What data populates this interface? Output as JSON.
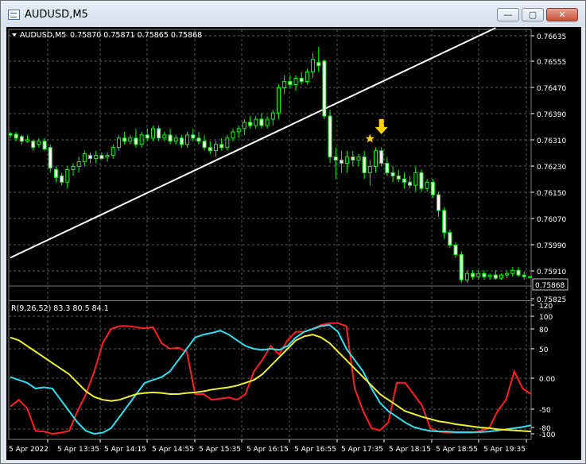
{
  "window": {
    "title": "AUDUSD,M5",
    "buttons": {
      "minimize": "—",
      "maximize": "▢",
      "close": "✕"
    }
  },
  "chart_data": {
    "symbol_label": "AUDUSD,M5",
    "ohlc_label": "0.75870 0.75871 0.75865 0.75868",
    "price_axis": [
      "0.76635",
      "0.76555",
      "0.76470",
      "0.76390",
      "0.76310",
      "0.76230",
      "0.76150",
      "0.76070",
      "0.75990",
      "0.75910",
      "0.75825"
    ],
    "current_price": "0.75868",
    "indicator_label": "R(9,26,52) 83.3 80.5 84.1",
    "indicator_axis": [
      "120",
      "100",
      "80",
      "50",
      "0.00",
      "-50",
      "-80",
      "-100"
    ],
    "time_axis": [
      "5 Apr 2022",
      "5 Apr 13:35",
      "5 Apr 14:15",
      "5 Apr 14:55",
      "5 Apr 15:35",
      "5 Apr 16:15",
      "5 Apr 16:55",
      "5 Apr 17:35",
      "5 Apr 18:15",
      "5 Apr 18:55",
      "5 Apr 19:35"
    ],
    "candles": [
      [
        0.76324,
        0.7633,
        0.7631,
        0.7632
      ],
      [
        0.76322,
        0.7633,
        0.763,
        0.7631
      ],
      [
        0.76315,
        0.7632,
        0.7629,
        0.763
      ],
      [
        0.763,
        0.7632,
        0.76295,
        0.76305
      ],
      [
        0.763,
        0.76305,
        0.7627,
        0.7628
      ],
      [
        0.7629,
        0.7631,
        0.7628,
        0.763
      ],
      [
        0.763,
        0.7631,
        0.7627,
        0.76275
      ],
      [
        0.7628,
        0.7629,
        0.762,
        0.76215
      ],
      [
        0.7621,
        0.7622,
        0.7617,
        0.76185
      ],
      [
        0.7619,
        0.762,
        0.7616,
        0.7617
      ],
      [
        0.7617,
        0.7622,
        0.7615,
        0.7621
      ],
      [
        0.7621,
        0.7623,
        0.7619,
        0.7622
      ],
      [
        0.7622,
        0.7625,
        0.762,
        0.76235
      ],
      [
        0.76235,
        0.7627,
        0.7622,
        0.7626
      ],
      [
        0.76255,
        0.76265,
        0.7623,
        0.76245
      ],
      [
        0.76245,
        0.7627,
        0.7623,
        0.76255
      ],
      [
        0.76255,
        0.76265,
        0.7624,
        0.76245
      ],
      [
        0.7625,
        0.76265,
        0.76235,
        0.76255
      ],
      [
        0.76255,
        0.7629,
        0.76245,
        0.7628
      ],
      [
        0.7628,
        0.7632,
        0.7627,
        0.7631
      ],
      [
        0.7631,
        0.7633,
        0.7629,
        0.763
      ],
      [
        0.763,
        0.7632,
        0.7629,
        0.7631
      ],
      [
        0.7631,
        0.7634,
        0.7628,
        0.7629
      ],
      [
        0.7629,
        0.7633,
        0.7628,
        0.7632
      ],
      [
        0.7632,
        0.7634,
        0.763,
        0.7631
      ],
      [
        0.7631,
        0.7635,
        0.763,
        0.7634
      ],
      [
        0.7634,
        0.7635,
        0.763,
        0.7631
      ],
      [
        0.7631,
        0.7633,
        0.763,
        0.7632
      ],
      [
        0.7632,
        0.7634,
        0.7629,
        0.763
      ],
      [
        0.763,
        0.7632,
        0.7629,
        0.7631
      ],
      [
        0.7631,
        0.7632,
        0.7628,
        0.7629
      ],
      [
        0.7629,
        0.7633,
        0.7628,
        0.7632
      ],
      [
        0.7632,
        0.7634,
        0.763,
        0.7631
      ],
      [
        0.7631,
        0.7633,
        0.7629,
        0.763
      ],
      [
        0.763,
        0.7632,
        0.7627,
        0.7628
      ],
      [
        0.7628,
        0.763,
        0.7626,
        0.7627
      ],
      [
        0.7627,
        0.763,
        0.7625,
        0.7629
      ],
      [
        0.7629,
        0.7631,
        0.7627,
        0.7628
      ],
      [
        0.7628,
        0.7632,
        0.7627,
        0.7631
      ],
      [
        0.7631,
        0.7634,
        0.763,
        0.7633
      ],
      [
        0.7633,
        0.7635,
        0.7631,
        0.7634
      ],
      [
        0.7634,
        0.7637,
        0.7632,
        0.7636
      ],
      [
        0.7636,
        0.7638,
        0.7634,
        0.7635
      ],
      [
        0.7635,
        0.7638,
        0.7634,
        0.7637
      ],
      [
        0.7637,
        0.7639,
        0.7634,
        0.7635
      ],
      [
        0.7635,
        0.7638,
        0.7634,
        0.7637
      ],
      [
        0.7637,
        0.764,
        0.7635,
        0.7639
      ],
      [
        0.7639,
        0.7648,
        0.7637,
        0.7647
      ],
      [
        0.7647,
        0.7651,
        0.7645,
        0.7649
      ],
      [
        0.7649,
        0.7651,
        0.7647,
        0.7648
      ],
      [
        0.7648,
        0.7651,
        0.7646,
        0.765
      ],
      [
        0.765,
        0.7652,
        0.7648,
        0.7649
      ],
      [
        0.7649,
        0.7653,
        0.7648,
        0.7652
      ],
      [
        0.7652,
        0.7658,
        0.765,
        0.7656
      ],
      [
        0.7655,
        0.766,
        0.7652,
        0.7654
      ],
      [
        0.76555,
        0.7656,
        0.7637,
        0.7638
      ],
      [
        0.7638,
        0.764,
        0.7623,
        0.7625
      ],
      [
        0.7625,
        0.7628,
        0.7618,
        0.7624
      ],
      [
        0.7624,
        0.7627,
        0.762,
        0.7623
      ],
      [
        0.7623,
        0.7627,
        0.762,
        0.7625
      ],
      [
        0.7625,
        0.7627,
        0.7622,
        0.7624
      ],
      [
        0.7624,
        0.7626,
        0.7622,
        0.7625
      ],
      [
        0.7625,
        0.7627,
        0.7618,
        0.762
      ],
      [
        0.762,
        0.7624,
        0.7616,
        0.7622
      ],
      [
        0.7622,
        0.7628,
        0.762,
        0.7627
      ],
      [
        0.7627,
        0.7628,
        0.7622,
        0.7623
      ],
      [
        0.7623,
        0.7625,
        0.7619,
        0.762
      ],
      [
        0.762,
        0.7622,
        0.7617,
        0.7619
      ],
      [
        0.7619,
        0.7621,
        0.7617,
        0.7618
      ],
      [
        0.7618,
        0.762,
        0.7615,
        0.7617
      ],
      [
        0.7617,
        0.7619,
        0.7615,
        0.7616
      ],
      [
        0.7616,
        0.7622,
        0.7614,
        0.762
      ],
      [
        0.762,
        0.7621,
        0.7614,
        0.7615
      ],
      [
        0.7615,
        0.7618,
        0.7614,
        0.7617
      ],
      [
        0.7617,
        0.7618,
        0.7612,
        0.7613
      ],
      [
        0.7613,
        0.7614,
        0.7606,
        0.7608
      ],
      [
        0.7608,
        0.7609,
        0.7599,
        0.7601
      ],
      [
        0.7601,
        0.7602,
        0.7596,
        0.7597
      ],
      [
        0.7597,
        0.7598,
        0.7593,
        0.7594
      ],
      [
        0.7594,
        0.7595,
        0.7585,
        0.7586
      ],
      [
        0.7586,
        0.7589,
        0.7585,
        0.7588
      ],
      [
        0.7588,
        0.7589,
        0.7586,
        0.7587
      ],
      [
        0.7587,
        0.7589,
        0.7586,
        0.7588
      ],
      [
        0.7588,
        0.7589,
        0.7586,
        0.7587
      ],
      [
        0.7587,
        0.7588,
        0.7586,
        0.75875
      ],
      [
        0.75875,
        0.7589,
        0.7586,
        0.75865
      ],
      [
        0.75865,
        0.7588,
        0.7586,
        0.75875
      ],
      [
        0.75875,
        0.7589,
        0.75865,
        0.7588
      ],
      [
        0.7588,
        0.759,
        0.7587,
        0.7589
      ],
      [
        0.7589,
        0.759,
        0.7587,
        0.75875
      ],
      [
        0.75875,
        0.75885,
        0.7586,
        0.7587
      ],
      [
        0.7587,
        0.75871,
        0.75865,
        0.75868
      ]
    ],
    "series": [
      {
        "name": "9",
        "color": "#ff2020",
        "values": [
          -52,
          -40,
          -55,
          -95,
          -96,
          -100,
          -98,
          -95,
          -60,
          -30,
          10,
          60,
          85,
          90,
          90,
          88,
          86,
          88,
          60,
          50,
          52,
          45,
          -30,
          -30,
          -40,
          -38,
          -36,
          -40,
          -30,
          10,
          30,
          55,
          40,
          65,
          80,
          80,
          85,
          92,
          95,
          95,
          90,
          -20,
          -60,
          -90,
          -94,
          -80,
          -10,
          -10,
          -30,
          -50,
          -90,
          -96,
          -98,
          -98,
          -98,
          -98,
          -95,
          -90,
          -60,
          -40,
          10,
          -20,
          -30
        ]
      },
      {
        "name": "26",
        "color": "#30e0f0",
        "values": [
          0,
          -5,
          -10,
          -20,
          -18,
          -20,
          -40,
          -60,
          -80,
          -95,
          -100,
          -98,
          -90,
          -70,
          -50,
          -30,
          -10,
          -5,
          0,
          10,
          30,
          50,
          70,
          75,
          78,
          82,
          75,
          65,
          55,
          50,
          48,
          50,
          48,
          55,
          70,
          80,
          85,
          90,
          92,
          80,
          50,
          30,
          10,
          -20,
          -45,
          -60,
          -70,
          -80,
          -88,
          -92,
          -95,
          -96,
          -96,
          -97,
          -97,
          -97,
          -97,
          -96,
          -94,
          -92,
          -90,
          -88,
          -85
        ]
      },
      {
        "name": "52",
        "color": "#f0f030",
        "values": [
          70,
          65,
          55,
          45,
          35,
          25,
          15,
          5,
          -10,
          -25,
          -35,
          -40,
          -42,
          -40,
          -35,
          -30,
          -28,
          -27,
          -28,
          -30,
          -30,
          -28,
          -27,
          -25,
          -22,
          -20,
          -18,
          -15,
          -10,
          -5,
          5,
          20,
          35,
          50,
          65,
          72,
          75,
          70,
          60,
          45,
          30,
          15,
          0,
          -15,
          -30,
          -40,
          -50,
          -60,
          -65,
          -70,
          -74,
          -78,
          -80,
          -83,
          -85,
          -87,
          -89,
          -90,
          -92,
          -93,
          -94,
          -95,
          -96
        ]
      }
    ],
    "trendline": {
      "start": {
        "bar": 0,
        "price": 0.7593
      },
      "end": {
        "bar": 85,
        "price": 0.7666
      }
    },
    "signal_arrow": {
      "bar": 65,
      "price": 0.76335
    },
    "signal_star": {
      "bar": 63,
      "price": 0.76308
    }
  }
}
